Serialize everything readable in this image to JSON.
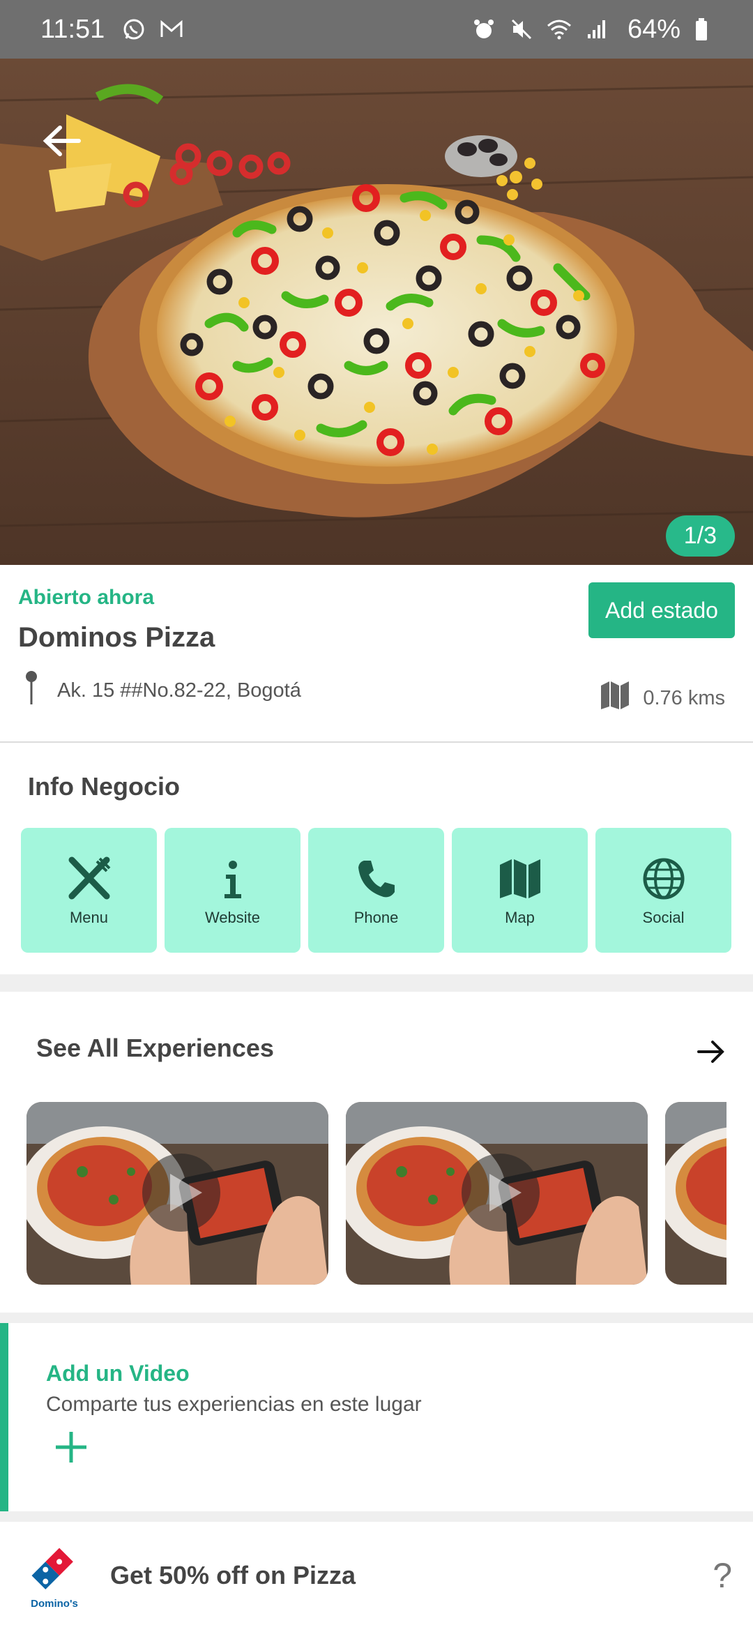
{
  "status_bar": {
    "time": "11:51",
    "battery": "64%",
    "left_icons": [
      "whatsapp-icon",
      "gmail-icon"
    ],
    "right_icons": [
      "alarm-icon",
      "mute-icon",
      "wifi-icon",
      "signal-icon",
      "battery-icon"
    ]
  },
  "hero": {
    "counter": "1/3",
    "back_icon": "arrow-left-icon"
  },
  "business": {
    "status": "Abierto ahora",
    "name": "Dominos Pizza",
    "add_button": "Add estado",
    "address": "Ak. 15 ##No.82-22, Bogotá",
    "distance": "0.76 kms",
    "colors": {
      "accent": "#25b585",
      "tile_bg": "#a3f6dc"
    }
  },
  "info": {
    "title": "Info Negocio",
    "tiles": [
      {
        "label": "Menu",
        "icon": "utensils-icon"
      },
      {
        "label": "Website",
        "icon": "info-icon"
      },
      {
        "label": "Phone",
        "icon": "phone-icon"
      },
      {
        "label": "Map",
        "icon": "map-icon"
      },
      {
        "label": "Social",
        "icon": "globe-icon"
      }
    ]
  },
  "experiences": {
    "title": "See All Experiences"
  },
  "add_video": {
    "title": "Add un Video",
    "subtitle": "Comparte tus experiencias en este lugar"
  },
  "promo": {
    "brand": "Domino's",
    "text": "Get 50% off on Pizza",
    "help": "?"
  }
}
